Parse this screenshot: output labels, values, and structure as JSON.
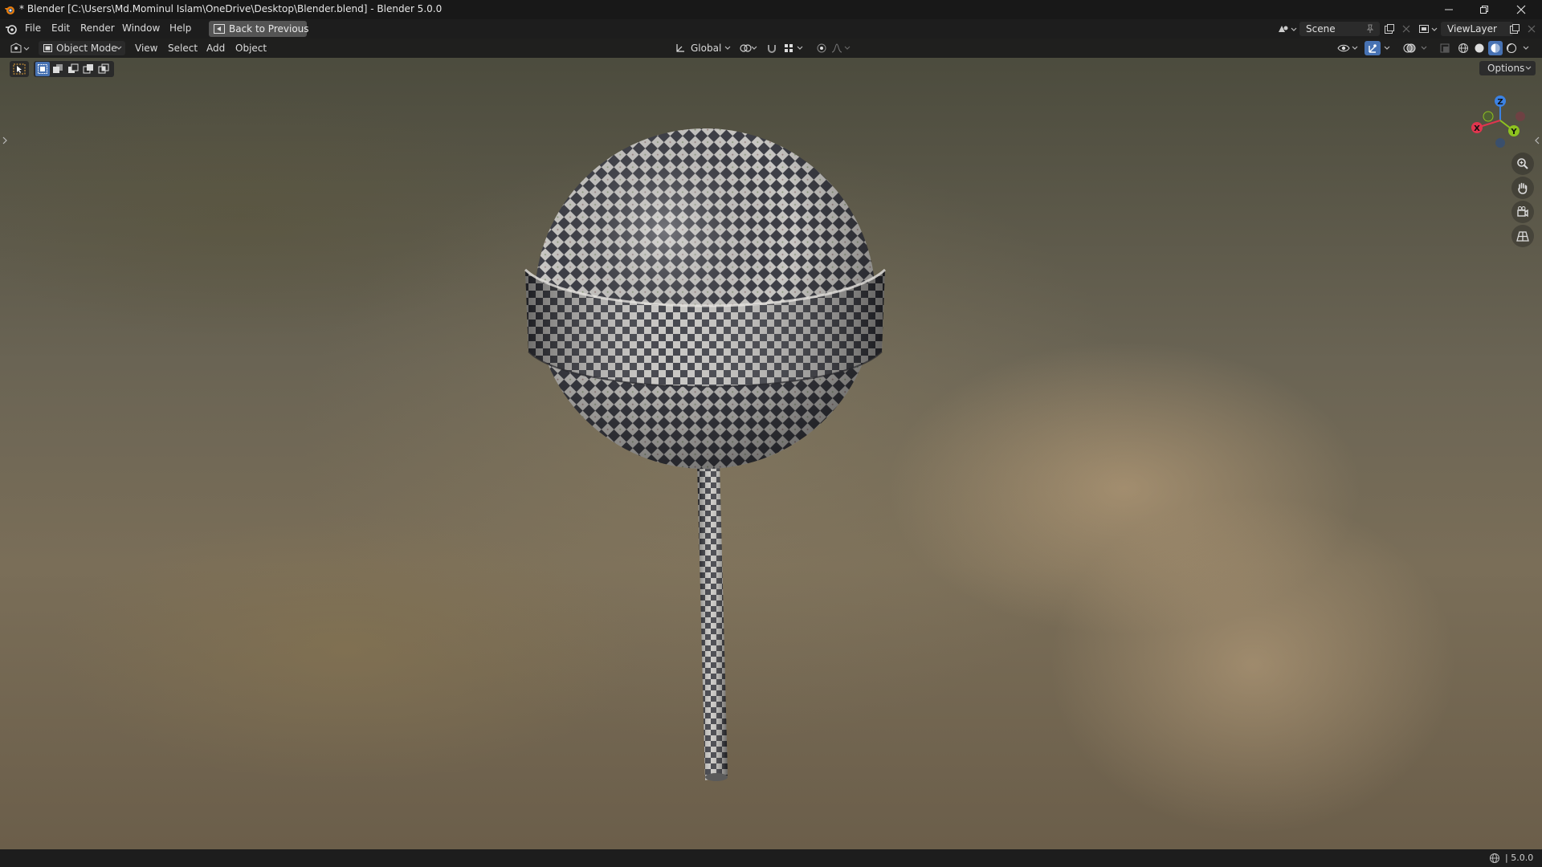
{
  "window": {
    "title": "* Blender [C:\\Users\\Md.Mominul Islam\\OneDrive\\Desktop\\Blender.blend] - Blender 5.0.0"
  },
  "top_menu": {
    "items": [
      {
        "label": "File"
      },
      {
        "label": "Edit"
      },
      {
        "label": "Render"
      },
      {
        "label": "Window"
      },
      {
        "label": "Help"
      }
    ],
    "back_button": "Back to Previous",
    "scene": "Scene",
    "view_layer": "ViewLayer"
  },
  "viewport": {
    "mode": "Object Mode",
    "menus": [
      {
        "label": "View"
      },
      {
        "label": "Select"
      },
      {
        "label": "Add"
      },
      {
        "label": "Object"
      }
    ],
    "orientation": "Global",
    "options_label": "Options",
    "gizmo_axes": {
      "z": "Z",
      "x": "X",
      "y": "Y"
    },
    "axis_colors": {
      "x": "#e0354e",
      "y": "#8dc21f",
      "z": "#3b82e4"
    },
    "object": "checker-textured lollipop (sphere with band and stick)",
    "nav_icons": [
      "zoom-icon",
      "pan-hand-icon",
      "camera-icon",
      "grid-perspective-icon"
    ]
  },
  "status_bar": {
    "version": "5.0.0"
  },
  "colors": {
    "titlebar": "#181818",
    "header": "#1d1d1d",
    "button": "#545454",
    "accent_blue": "#4772b3"
  }
}
